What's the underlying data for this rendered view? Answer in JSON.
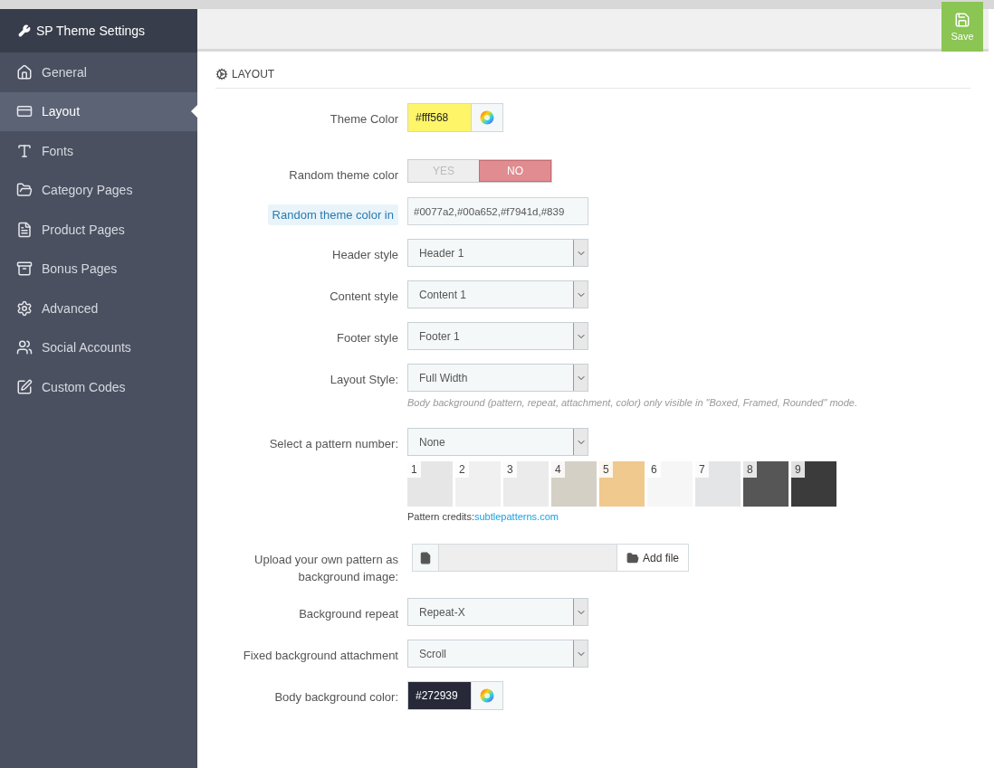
{
  "sidebar": {
    "title": "SP Theme Settings",
    "items": [
      {
        "label": "General",
        "selected": false
      },
      {
        "label": "Layout",
        "selected": true
      },
      {
        "label": "Fonts",
        "selected": false
      },
      {
        "label": "Category Pages",
        "selected": false
      },
      {
        "label": "Product Pages",
        "selected": false
      },
      {
        "label": "Bonus Pages",
        "selected": false
      },
      {
        "label": "Advanced",
        "selected": false
      },
      {
        "label": "Social Accounts",
        "selected": false
      },
      {
        "label": "Custom Codes",
        "selected": false
      }
    ]
  },
  "toolbar": {
    "save_label": "Save"
  },
  "section": {
    "title": "LAYOUT"
  },
  "fields": [
    {
      "kind": "color",
      "label": "Theme Color",
      "value": "#fff568",
      "color": "#fff568"
    },
    {
      "kind": "toggle",
      "label": "Random theme color",
      "options": [
        {
          "label": "YES",
          "selected": false
        },
        {
          "label": "NO",
          "selected": true
        }
      ]
    },
    {
      "kind": "text",
      "label": "Random theme color in",
      "highlighted": true,
      "value": "#0077a2,#00a652,#f7941d,#839"
    },
    {
      "kind": "select",
      "label": "Header style",
      "value": "Header 1"
    },
    {
      "kind": "select",
      "label": "Content style",
      "value": "Content 1"
    },
    {
      "kind": "select",
      "label": "Footer style",
      "value": "Footer 1"
    },
    {
      "kind": "select",
      "label": "Layout Style:",
      "value": "Full Width",
      "help": "Body background (pattern, repeat, attachment, color) only visible in \"Boxed, Framed, Rounded\" mode."
    },
    {
      "kind": "select",
      "label": "Select a pattern number:",
      "value": "None",
      "patterns": [
        {
          "number": "1",
          "color": "#e6e6e6"
        },
        {
          "number": "2",
          "color": "#f0f0f0"
        },
        {
          "number": "3",
          "color": "#ebebeb"
        },
        {
          "number": "4",
          "color": "#d4d0c6"
        },
        {
          "number": "5",
          "color": "#efc98d"
        },
        {
          "number": "6",
          "color": "#f6f6f6"
        },
        {
          "number": "7",
          "color": "#e3e5e7"
        },
        {
          "number": "8",
          "color": "#565656"
        },
        {
          "number": "9",
          "color": "#3b3b3b"
        }
      ],
      "credits_label": "Pattern credits:",
      "credits_link": "subtlepatterns.com"
    },
    {
      "kind": "file",
      "label": "Upload your own pattern as background image:",
      "button": "Add file"
    },
    {
      "kind": "select",
      "label": "Background repeat",
      "value": "Repeat-X"
    },
    {
      "kind": "select",
      "label": "Fixed background attachment",
      "value": "Scroll"
    },
    {
      "kind": "color",
      "label": "Body background color:",
      "value": "#272939",
      "color": "#272939"
    }
  ]
}
